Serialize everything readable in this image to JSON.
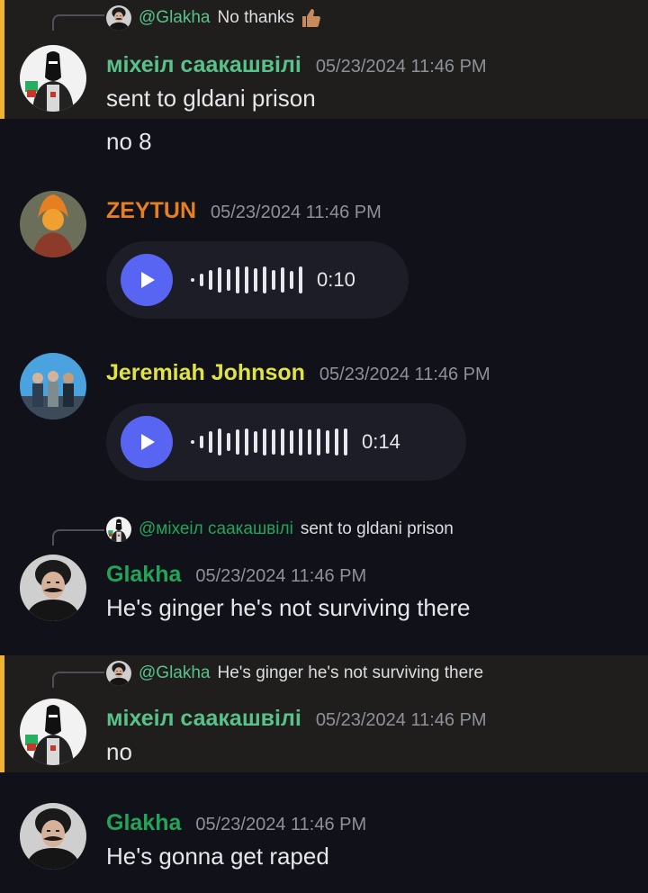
{
  "colors": {
    "background": "#111119",
    "highlight": "#1f1e1c",
    "highlight_bar": "#f0b232",
    "mention": "#58c28a",
    "green_name": "#23a559",
    "orange_name": "#e67e22",
    "yellow_name": "#e0e341",
    "play": "#5865f2",
    "timestamp": "#8e9199"
  },
  "messages": [
    {
      "highlighted": true,
      "reply": {
        "mention": "@Glakha",
        "text": "No thanks",
        "emoji": "thumbs-up-emoji"
      },
      "author": "міхеіл саакашвілі",
      "timestamp": "05/23/2024 11:46 PM",
      "lines": [
        "sent to gldani prison"
      ],
      "avatar_icon": "masked-figure-avatar"
    },
    {
      "highlighted": false,
      "continuation": "no 8"
    },
    {
      "highlighted": false,
      "author": "ZEYTUN",
      "timestamp": "05/23/2024 11:46 PM",
      "avatar_icon": "red-flame-character-avatar",
      "voice": {
        "duration": "0:10",
        "play_icon": "play-icon"
      }
    },
    {
      "highlighted": false,
      "author": "Jeremiah Johnson",
      "timestamp": "05/23/2024 11:46 PM",
      "avatar_icon": "group-photo-avatar",
      "voice": {
        "duration": "0:14",
        "play_icon": "play-icon"
      }
    },
    {
      "highlighted": false,
      "reply": {
        "mention": "@міхеіл саакашвілі",
        "text": "sent to gldani prison"
      },
      "author": "Glakha",
      "timestamp": "05/23/2024 11:46 PM",
      "avatar_icon": "mustached-man-avatar",
      "lines": [
        "He's ginger he's not surviving there"
      ]
    },
    {
      "highlighted": true,
      "reply": {
        "mention": "@Glakha",
        "text": "He's ginger he's not surviving there"
      },
      "author": "міхеіл саакашвілі",
      "timestamp": "05/23/2024 11:46 PM",
      "avatar_icon": "masked-figure-avatar",
      "lines": [
        "no"
      ]
    },
    {
      "highlighted": false,
      "author": "Glakha",
      "timestamp": "05/23/2024 11:46 PM",
      "avatar_icon": "mustached-man-avatar",
      "lines": [
        "He's gonna get raped"
      ]
    }
  ]
}
